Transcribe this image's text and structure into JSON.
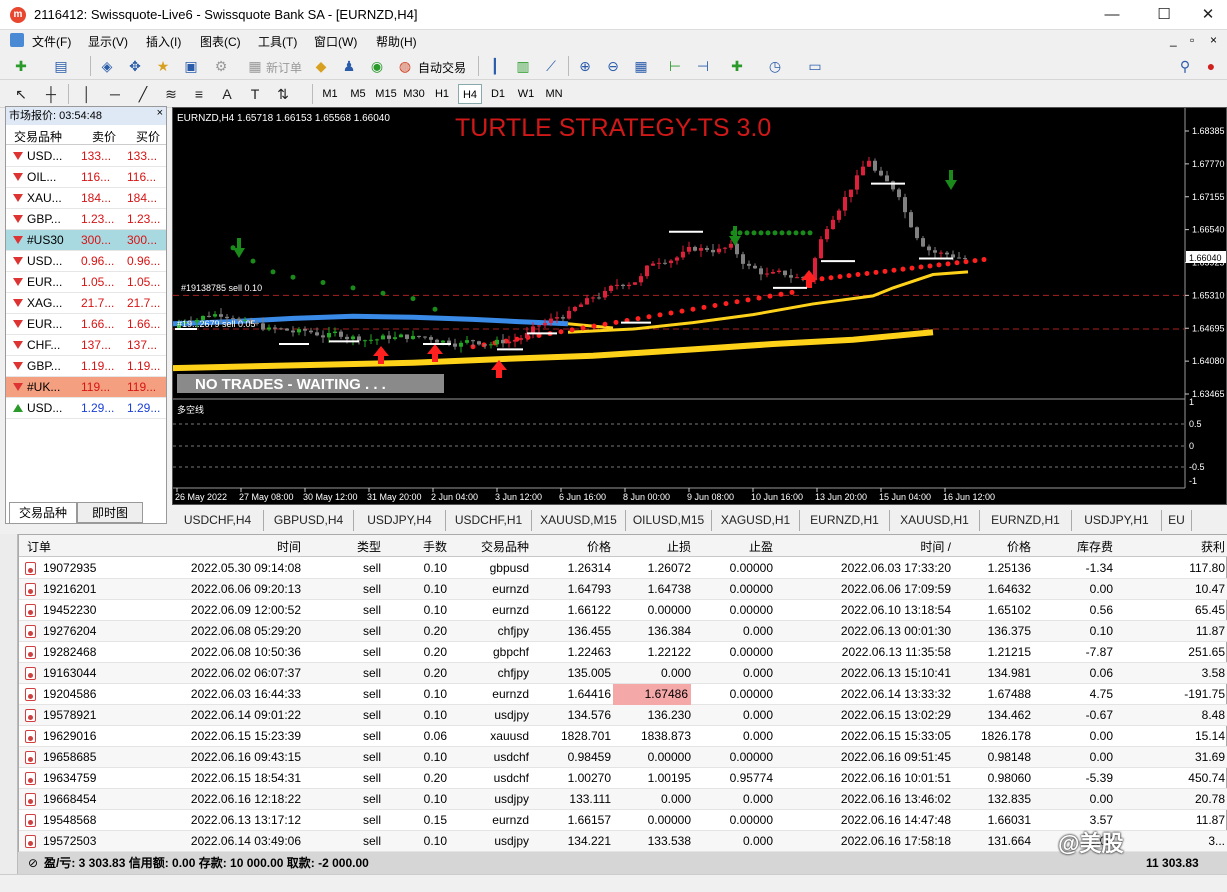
{
  "window": {
    "title": "2116412: Swissquote-Live6 - Swissquote Bank SA - [EURNZD,H4]",
    "minimize": "—",
    "maximize": "☐",
    "close": "✕"
  },
  "menu": [
    "文件(F)",
    "显示(V)",
    "插入(I)",
    "图表(C)",
    "工具(T)",
    "窗口(W)",
    "帮助(H)"
  ],
  "toolbar": {
    "new_order": "新订单",
    "auto_trade": "自动交易"
  },
  "timeframes": [
    "M1",
    "M5",
    "M15",
    "M30",
    "H1",
    "H4",
    "D1",
    "W1",
    "MN"
  ],
  "active_timeframe": "H4",
  "market_watch": {
    "title": "市场报价: 03:54:48",
    "close": "×",
    "col_symbol": "交易品种",
    "col_bid": "卖价",
    "col_ask": "买价",
    "rows": [
      {
        "symbol": "USD...",
        "bid": "133...",
        "ask": "133...",
        "dir": "down",
        "color": "red",
        "bg": ""
      },
      {
        "symbol": "OIL...",
        "bid": "116...",
        "ask": "116...",
        "dir": "down",
        "color": "red",
        "bg": ""
      },
      {
        "symbol": "XAU...",
        "bid": "184...",
        "ask": "184...",
        "dir": "down",
        "color": "red",
        "bg": ""
      },
      {
        "symbol": "GBP...",
        "bid": "1.23...",
        "ask": "1.23...",
        "dir": "down",
        "color": "red",
        "bg": ""
      },
      {
        "symbol": "#US30",
        "bid": "300...",
        "ask": "300...",
        "dir": "down",
        "color": "red",
        "bg": "#a8d8e0"
      },
      {
        "symbol": "USD...",
        "bid": "0.96...",
        "ask": "0.96...",
        "dir": "down",
        "color": "red",
        "bg": ""
      },
      {
        "symbol": "EUR...",
        "bid": "1.05...",
        "ask": "1.05...",
        "dir": "down",
        "color": "red",
        "bg": ""
      },
      {
        "symbol": "XAG...",
        "bid": "21.7...",
        "ask": "21.7...",
        "dir": "down",
        "color": "red",
        "bg": ""
      },
      {
        "symbol": "EUR...",
        "bid": "1.66...",
        "ask": "1.66...",
        "dir": "down",
        "color": "red",
        "bg": ""
      },
      {
        "symbol": "CHF...",
        "bid": "137...",
        "ask": "137...",
        "dir": "down",
        "color": "red",
        "bg": ""
      },
      {
        "symbol": "GBP...",
        "bid": "1.19...",
        "ask": "1.19...",
        "dir": "down",
        "color": "red",
        "bg": ""
      },
      {
        "symbol": "#UK...",
        "bid": "119...",
        "ask": "119...",
        "dir": "down",
        "color": "red",
        "bg": "#f4a080"
      },
      {
        "symbol": "USD...",
        "bid": "1.29...",
        "ask": "1.29...",
        "dir": "up",
        "color": "blue",
        "bg": ""
      }
    ],
    "tabs": [
      "交易品种",
      "即时图"
    ]
  },
  "chart": {
    "info": "EURNZD,H4  1.65718 1.66153 1.65568 1.66040",
    "overlay_title": "TURTLE STRATEGY-TS 3.0",
    "banner": "NO TRADES - WAITING . . .",
    "order_label_1": "#19138785 sell 0.10",
    "order_label_2": "#19...2679 sell 0.05",
    "sub_window_label": "多空线",
    "current_price": "1.66040",
    "price_ticks": [
      "1.68385",
      "1.67770",
      "1.67155",
      "1.66540",
      "1.65925",
      "1.65310",
      "1.64695",
      "1.64080",
      "1.63465"
    ],
    "sub_ticks": [
      "1",
      "0.5",
      "0",
      "-0.5",
      "-1"
    ],
    "time_ticks": [
      "26 May 2022",
      "27 May 08:00",
      "30 May 12:00",
      "31 May 20:00",
      "2 Jun 04:00",
      "3 Jun 12:00",
      "6 Jun 16:00",
      "8 Jun 00:00",
      "9 Jun 08:00",
      "10 Jun 16:00",
      "13 Jun 20:00",
      "15 Jun 04:00",
      "16 Jun 12:00"
    ],
    "colors": {
      "bull": "#22aa22",
      "bear": "#e0203a",
      "neutral": "#808080",
      "trend_blue": "#3a8ae8",
      "trend_yellow": "#ffd21a",
      "dots_red": "#ff2020",
      "dots_green": "#1a8a1a",
      "title_red": "#d01818"
    }
  },
  "chart_tabs": [
    "USDCHF,H4",
    "GBPUSD,H4",
    "USDJPY,H4",
    "USDCHF,H1",
    "XAUUSD,M15",
    "OILUSD,M15",
    "XAGUSD,H1",
    "EURNZD,H1",
    "XAUUSD,H1",
    "EURNZD,H1",
    "USDJPY,H1",
    "EU"
  ],
  "terminal": {
    "columns": [
      "订单",
      "时间",
      "类型",
      "手数",
      "交易品种",
      "价格",
      "止损",
      "止盈",
      "时间 /",
      "价格",
      "库存费",
      "获利"
    ],
    "rows": [
      [
        "19072935",
        "2022.05.30 09:14:08",
        "sell",
        "0.10",
        "gbpusd",
        "1.26314",
        "1.26072",
        "0.00000",
        "2022.06.03 17:33:20",
        "1.25136",
        "-1.34",
        "117.80"
      ],
      [
        "19216201",
        "2022.06.06 09:20:13",
        "sell",
        "0.10",
        "eurnzd",
        "1.64793",
        "1.64738",
        "0.00000",
        "2022.06.06 17:09:59",
        "1.64632",
        "0.00",
        "10.47"
      ],
      [
        "19452230",
        "2022.06.09 12:00:52",
        "sell",
        "0.10",
        "eurnzd",
        "1.66122",
        "0.00000",
        "0.00000",
        "2022.06.10 13:18:54",
        "1.65102",
        "0.56",
        "65.45"
      ],
      [
        "19276204",
        "2022.06.08 05:29:20",
        "sell",
        "0.20",
        "chfjpy",
        "136.455",
        "136.384",
        "0.000",
        "2022.06.13 00:01:30",
        "136.375",
        "0.10",
        "11.87"
      ],
      [
        "19282468",
        "2022.06.08 10:50:36",
        "sell",
        "0.20",
        "gbpchf",
        "1.22463",
        "1.22122",
        "0.00000",
        "2022.06.13 11:35:58",
        "1.21215",
        "-7.87",
        "251.65"
      ],
      [
        "19163044",
        "2022.06.02 06:07:37",
        "sell",
        "0.20",
        "chfjpy",
        "135.005",
        "0.000",
        "0.000",
        "2022.06.13 15:10:41",
        "134.981",
        "0.06",
        "3.58"
      ],
      [
        "19204586",
        "2022.06.03 16:44:33",
        "sell",
        "0.10",
        "eurnzd",
        "1.64416",
        "1.67486",
        "0.00000",
        "2022.06.14 13:33:32",
        "1.67488",
        "4.75",
        "-191.75"
      ],
      [
        "19578921",
        "2022.06.14 09:01:22",
        "sell",
        "0.10",
        "usdjpy",
        "134.576",
        "136.230",
        "0.000",
        "2022.06.15 13:02:29",
        "134.462",
        "-0.67",
        "8.48"
      ],
      [
        "19629016",
        "2022.06.15 15:23:39",
        "sell",
        "0.06",
        "xauusd",
        "1828.701",
        "1838.873",
        "0.000",
        "2022.06.15 15:33:05",
        "1826.178",
        "0.00",
        "15.14"
      ],
      [
        "19658685",
        "2022.06.16 09:43:15",
        "sell",
        "0.10",
        "usdchf",
        "0.98459",
        "0.00000",
        "0.00000",
        "2022.06.16 09:51:45",
        "0.98148",
        "0.00",
        "31.69"
      ],
      [
        "19634759",
        "2022.06.15 18:54:31",
        "sell",
        "0.20",
        "usdchf",
        "1.00270",
        "1.00195",
        "0.95774",
        "2022.06.16 10:01:51",
        "0.98060",
        "-5.39",
        "450.74"
      ],
      [
        "19668454",
        "2022.06.16 12:18:22",
        "sell",
        "0.10",
        "usdjpy",
        "133.111",
        "0.000",
        "0.000",
        "2022.06.16 13:46:02",
        "132.835",
        "0.00",
        "20.78"
      ],
      [
        "19548568",
        "2022.06.13 13:17:12",
        "sell",
        "0.15",
        "eurnzd",
        "1.66157",
        "0.00000",
        "0.00000",
        "2022.06.16 14:47:48",
        "1.66031",
        "3.57",
        "11.87"
      ],
      [
        "19572503",
        "2022.06.14 03:49:06",
        "sell",
        "0.10",
        "usdjpy",
        "134.221",
        "133.538",
        "0.000",
        "2022.06.16 17:58:18",
        "131.664",
        "0.00",
        "3..."
      ]
    ],
    "highlight_row": 6,
    "highlight_col": 6,
    "summary": "盈/亏: 3 303.83  信用额: 0.00  存款: 10 000.00  取款: -2 000.00",
    "total": "11 303.83"
  },
  "watermark": "@美股"
}
